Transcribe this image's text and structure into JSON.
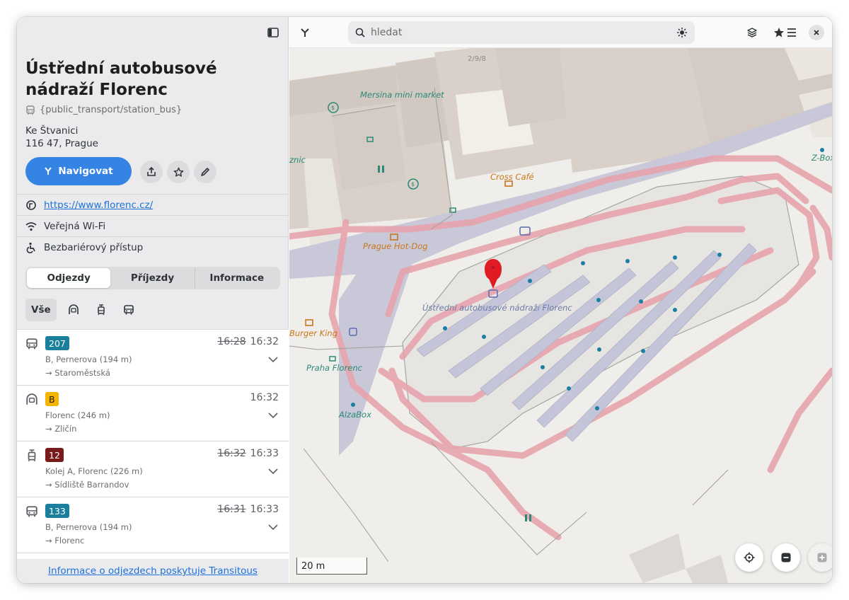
{
  "sidebar": {
    "title": "Ústřední autobusové nádraží Florenc",
    "category": "{public_transport/station_bus}",
    "address_line1": "Ke Štvanici",
    "address_line2": "116 47, Prague",
    "navigate_label": "Navigovat",
    "website": "https://www.florenc.cz/",
    "wifi": "Veřejná Wi-Fi",
    "accessibility": "Bezbariérový přístup",
    "tabs": [
      "Odjezdy",
      "Příjezdy",
      "Informace"
    ],
    "filter_all": "Vše",
    "departures": [
      {
        "mode": "bus",
        "line": "207",
        "color": "#1a7f9c",
        "time_old": "16:28",
        "time": "16:32",
        "stop": "B, Pernerova (194 m)",
        "dir": "→ Staroměstská"
      },
      {
        "mode": "metro",
        "line": "B",
        "color": "#f5b400",
        "time_old": "",
        "time": "16:32",
        "stop": "Florenc (246 m)",
        "dir": "→ Zličín"
      },
      {
        "mode": "tram",
        "line": "12",
        "color": "#7a1b1b",
        "time_old": "16:32",
        "time": "16:33",
        "stop": "Kolej A, Florenc (226 m)",
        "dir": "→ Sídliště Barrandov"
      },
      {
        "mode": "bus",
        "line": "133",
        "color": "#1a7f9c",
        "time_old": "16:31",
        "time": "16:33",
        "stop": "B, Pernerova (194 m)",
        "dir": "→ Florenc"
      }
    ],
    "footer": "Informace o odjezdech poskytuje Transitous"
  },
  "map": {
    "search_placeholder": "hledat",
    "scale": "20 m",
    "labels": {
      "mersina": "Mersina mini market",
      "cross_cafe": "Cross Café",
      "prague_hotdog": "Prague Hot-Dog",
      "burger_king": "Burger King",
      "praha_florenc": "Praha Florenc",
      "alzabox": "AlzaBox",
      "station": "Ústřední autobusové nádraží Florenc",
      "zbox": "Z-Box",
      "znic": "znic",
      "house_no": "2/9/8"
    }
  }
}
